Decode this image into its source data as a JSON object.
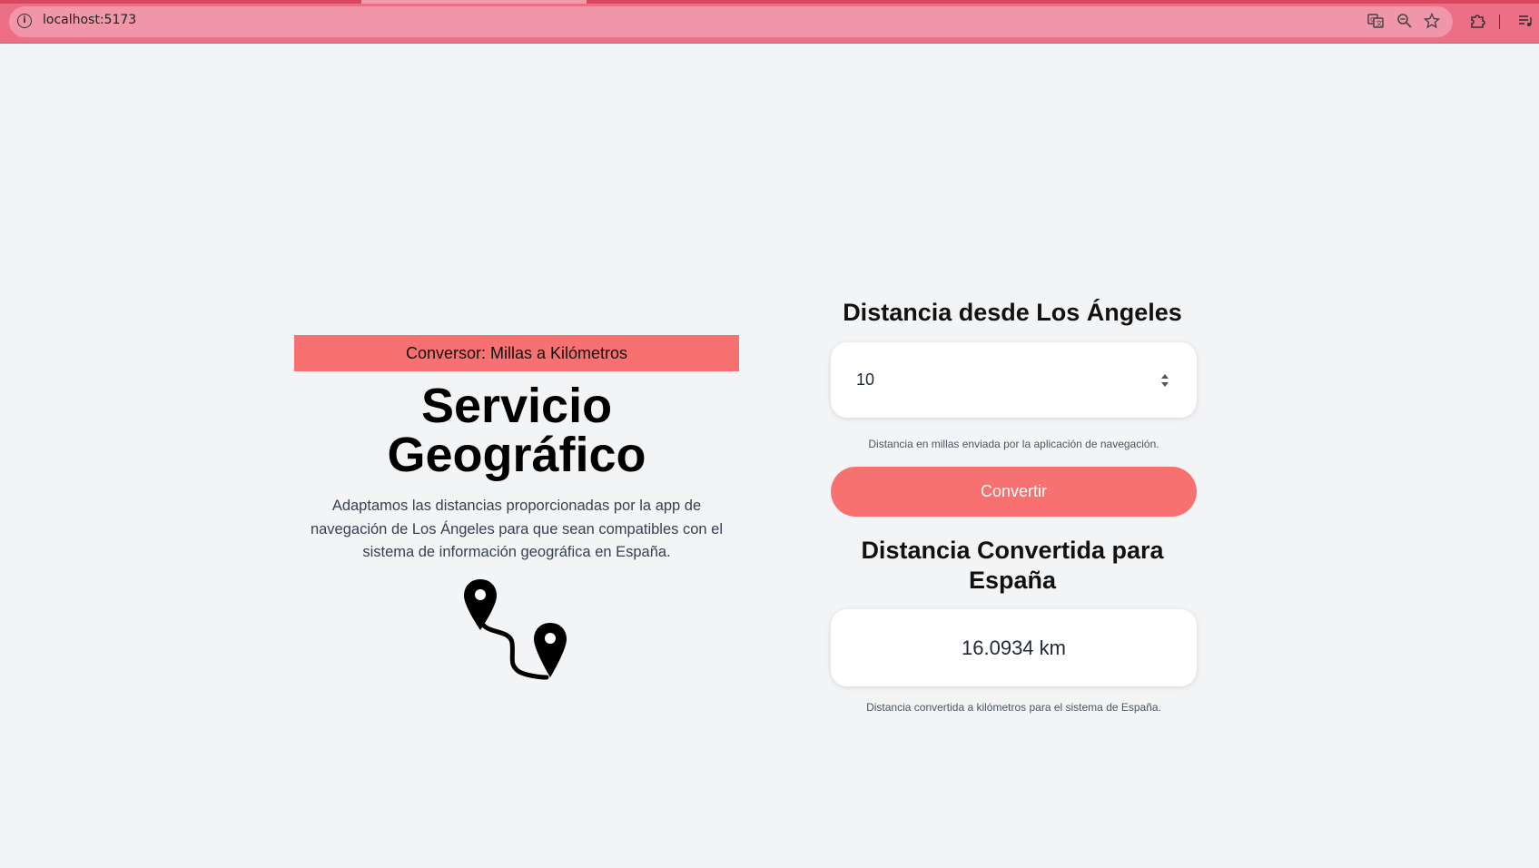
{
  "browser": {
    "url": "localhost:5173",
    "toolbar_icons": [
      "translate-icon",
      "zoom-icon",
      "bookmark-star-icon",
      "extensions-icon",
      "media-controls-icon"
    ]
  },
  "left": {
    "banner": "Conversor: Millas a Kilómetros",
    "title_line1": "Servicio",
    "title_line2": "Geográfico",
    "description": "Adaptamos las distancias proporcionadas por la app de navegación de Los Ángeles para que sean compatibles con el sistema de información geográfica en España.",
    "illustration": "route-pins-icon"
  },
  "right": {
    "input_heading": "Distancia desde Los Ángeles",
    "input_value": "10",
    "input_helper": "Distancia en millas enviada por la aplicación de navegación.",
    "button_label": "Convertir",
    "result_heading_line1": "Distancia Convertida para",
    "result_heading_line2": "España",
    "result_value": "16.0934 km",
    "result_helper": "Distancia convertida a kilómetros para el sistema de España."
  },
  "colors": {
    "accent": "#f87171",
    "browser_bar": "#ec6f85",
    "background": "#f3f4f6"
  }
}
